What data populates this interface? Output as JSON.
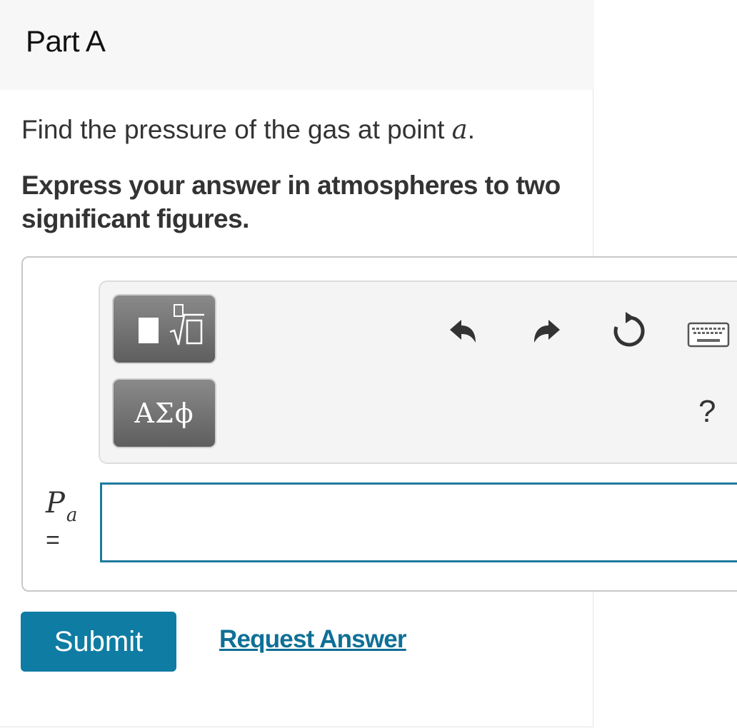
{
  "part": {
    "title": "Part A"
  },
  "question": {
    "prefix": "Find the pressure of the gas at point ",
    "variable": "a",
    "suffix": "."
  },
  "instruction": {
    "text": "Express your answer in atmospheres to two significant figures."
  },
  "toolbar": {
    "templates_icon": "sqrt-template-icon",
    "greek_label": "ΑΣϕ",
    "undo_icon": "undo-icon",
    "redo_icon": "redo-icon",
    "reset_icon": "reset-icon",
    "keyboard_icon": "keyboard-icon",
    "help_label": "?"
  },
  "answer": {
    "symbol": "P",
    "subscript": "a",
    "equals": "=",
    "value": "",
    "placeholder": ""
  },
  "actions": {
    "submit_label": "Submit",
    "request_answer_label": "Request Answer"
  },
  "colors": {
    "accent": "#0f7ca3",
    "link": "#0f6f96",
    "input_border": "#1f7a9e",
    "header_bg": "#f7f7f7"
  }
}
